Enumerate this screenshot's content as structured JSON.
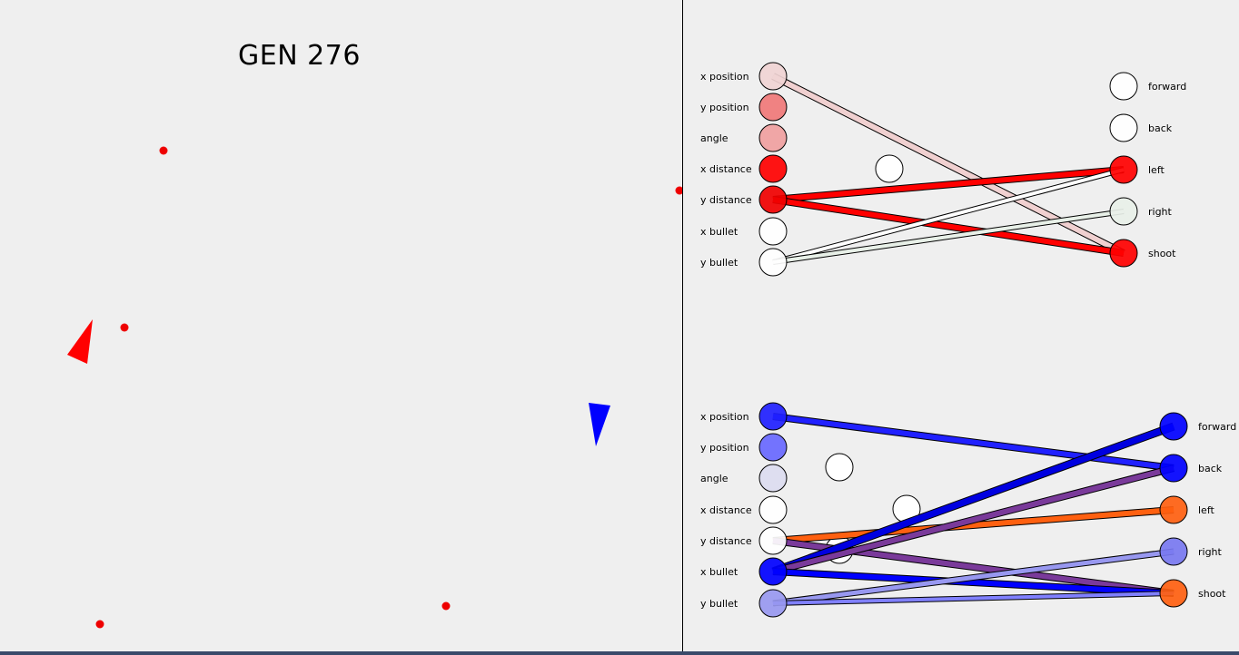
{
  "game": {
    "generation_label": "GEN 276"
  },
  "networks": [
    {
      "name": "red",
      "inputs": [
        {
          "label": "x position",
          "fill": "#f0d4d4"
        },
        {
          "label": "y position",
          "fill": "#f07878"
        },
        {
          "label": "angle",
          "fill": "#f0a0a0"
        },
        {
          "label": "x distance",
          "fill": "#ff0000"
        },
        {
          "label": "y distance",
          "fill": "#f00000"
        },
        {
          "label": "x bullet",
          "fill": "#ffffff"
        },
        {
          "label": "y bullet",
          "fill": "#ffffff"
        }
      ],
      "hidden": [
        {
          "fill": "#ffffff"
        }
      ],
      "outputs": [
        {
          "label": "forward",
          "fill": "#ffffff"
        },
        {
          "label": "back",
          "fill": "#ffffff"
        },
        {
          "label": "left",
          "fill": "#ff0000"
        },
        {
          "label": "right",
          "fill": "#e8f0e8"
        },
        {
          "label": "shoot",
          "fill": "#ff0000"
        }
      ],
      "connections": [
        {
          "from": "in0",
          "to": "out4",
          "color": "#f0d0d0",
          "weight": 6
        },
        {
          "from": "in4",
          "to": "out2",
          "color": "#ff0000",
          "weight": 6
        },
        {
          "from": "in4",
          "to": "out4",
          "color": "#ff0000",
          "weight": 6
        },
        {
          "from": "in6",
          "to": "out2",
          "color": "#ffffff",
          "weight": 4
        },
        {
          "from": "in6",
          "to": "out3",
          "color": "#e8f0e8",
          "weight": 4
        }
      ]
    },
    {
      "name": "blue",
      "inputs": [
        {
          "label": "x position",
          "fill": "#2020ff"
        },
        {
          "label": "y position",
          "fill": "#6868ff"
        },
        {
          "label": "angle",
          "fill": "#dcdcf0"
        },
        {
          "label": "x distance",
          "fill": "#ffffff"
        },
        {
          "label": "y distance",
          "fill": "#ffffff"
        },
        {
          "label": "x bullet",
          "fill": "#0000ff"
        },
        {
          "label": "y bullet",
          "fill": "#9898f0"
        }
      ],
      "hidden": [
        {
          "fill": "#ffffff"
        },
        {
          "fill": "#ffffff"
        },
        {
          "fill": "#ffffff"
        }
      ],
      "outputs": [
        {
          "label": "forward",
          "fill": "#0000ff"
        },
        {
          "label": "back",
          "fill": "#0000ff"
        },
        {
          "label": "left",
          "fill": "#ff6010"
        },
        {
          "label": "right",
          "fill": "#7878f0"
        },
        {
          "label": "shoot",
          "fill": "#ff6010"
        }
      ],
      "connections": [
        {
          "from": "in0",
          "to": "out1",
          "color": "#2020ff",
          "weight": 6
        },
        {
          "from": "in4",
          "to": "out2",
          "color": "#ff6010",
          "weight": 6
        },
        {
          "from": "in4",
          "to": "out4",
          "color": "#7a3a9a",
          "weight": 6
        },
        {
          "from": "in5",
          "to": "out0",
          "color": "#0000e0",
          "weight": 7
        },
        {
          "from": "in5",
          "to": "out1",
          "color": "#7a3a9a",
          "weight": 6
        },
        {
          "from": "in5",
          "to": "out4",
          "color": "#0000ff",
          "weight": 6
        },
        {
          "from": "in6",
          "to": "out3",
          "color": "#9898f0",
          "weight": 5
        },
        {
          "from": "in6",
          "to": "out4",
          "color": "#8080ff",
          "weight": 4
        }
      ]
    }
  ],
  "colors": {
    "red_ship": "#ff0000",
    "blue_ship": "#0000ff",
    "bullet": "#ee0000",
    "background": "#efefef"
  }
}
